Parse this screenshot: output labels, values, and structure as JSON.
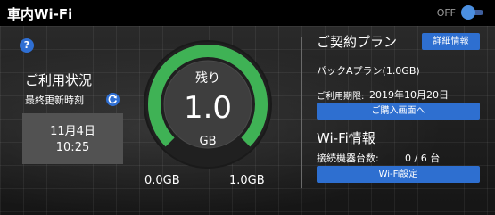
{
  "header": {
    "title": "車内Wi-Fi",
    "toggle_label": "OFF"
  },
  "usage": {
    "title": "ご利用状況",
    "last_updated_label": "最終更新時刻",
    "date": "11月4日",
    "time": "10:25"
  },
  "gauge": {
    "remaining_label": "残り",
    "value": "1.0",
    "unit": "GB",
    "min_label": "0.0GB",
    "max_label": "1.0GB",
    "fill_fraction": 1.0,
    "fill_color": "#3fb255",
    "track_color": "#565656"
  },
  "contract": {
    "title": "ご契約プラン",
    "detail_button": "詳細情報",
    "plan_name": "パックAプラン(1.0GB)",
    "expiry_label": "ご利用期限:",
    "expiry_value": "2019年10月20日",
    "purchase_button": "ご購入画面へ"
  },
  "wifi": {
    "title": "Wi-Fi情報",
    "devices_label": "接続機器台数:",
    "devices_value": "0 / 6 台",
    "settings_button": "Wi-Fi設定"
  },
  "icons": {
    "help": "help-icon",
    "refresh": "refresh-icon",
    "toggle": "toggle-switch"
  },
  "colors": {
    "accent": "#2e6fd0",
    "gauge_green": "#3fb255"
  }
}
